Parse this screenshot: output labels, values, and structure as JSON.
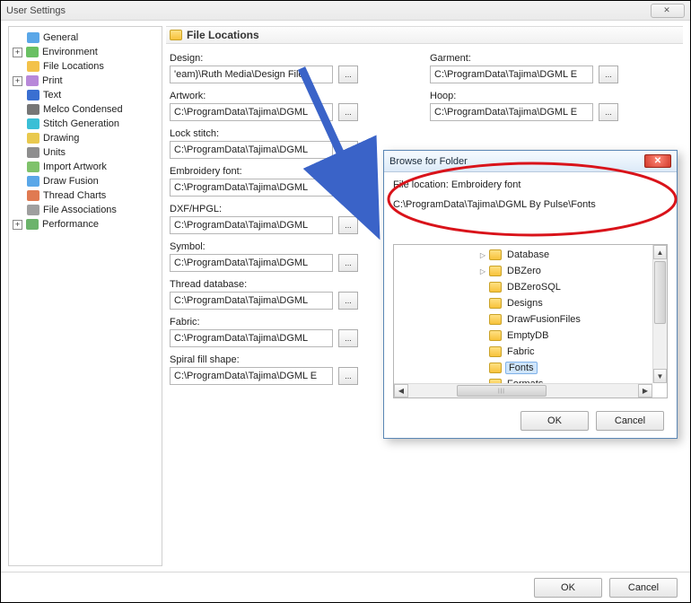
{
  "window": {
    "title": "User Settings",
    "close_glyph": "✕"
  },
  "sidebar": {
    "items": [
      {
        "label": "General",
        "expander": " ",
        "icon_color": "#5aa7e8"
      },
      {
        "label": "Environment",
        "expander": "+",
        "icon_color": "#69c063"
      },
      {
        "label": "File Locations",
        "expander": " ",
        "icon_color": "#f3c24a"
      },
      {
        "label": "Print",
        "expander": "+",
        "icon_color": "#b888d9"
      },
      {
        "label": "Text",
        "expander": " ",
        "icon_color": "#3a6fd1"
      },
      {
        "label": "Melco Condensed",
        "expander": " ",
        "icon_color": "#767676"
      },
      {
        "label": "Stitch Generation",
        "expander": " ",
        "icon_color": "#3abfd6"
      },
      {
        "label": "Drawing",
        "expander": " ",
        "icon_color": "#e9c94e"
      },
      {
        "label": "Units",
        "expander": " ",
        "icon_color": "#8e8e8e"
      },
      {
        "label": "Import Artwork",
        "expander": " ",
        "icon_color": "#7fc26b"
      },
      {
        "label": "Draw Fusion",
        "expander": " ",
        "icon_color": "#5aa7e8"
      },
      {
        "label": "Thread Charts",
        "expander": " ",
        "icon_color": "#e07a52"
      },
      {
        "label": "File Associations",
        "expander": " ",
        "icon_color": "#9f9f9f"
      },
      {
        "label": "Performance",
        "expander": "+",
        "icon_color": "#6bb36b"
      }
    ]
  },
  "panel": {
    "title": "File Locations",
    "left": [
      {
        "key": "design",
        "label": "Design:",
        "path": "'eam)\\Ruth Media\\Design Files"
      },
      {
        "key": "artwork",
        "label": "Artwork:",
        "path": "C:\\ProgramData\\Tajima\\DGML"
      },
      {
        "key": "lockstitch",
        "label": "Lock stitch:",
        "path": "C:\\ProgramData\\Tajima\\DGML"
      },
      {
        "key": "embfont",
        "label": "Embroidery font:",
        "path": "C:\\ProgramData\\Tajima\\DGML",
        "highlighted": true
      },
      {
        "key": "dxf",
        "label": "DXF/HPGL:",
        "path": "C:\\ProgramData\\Tajima\\DGML"
      },
      {
        "key": "symbol",
        "label": "Symbol:",
        "path": "C:\\ProgramData\\Tajima\\DGML"
      },
      {
        "key": "threaddb",
        "label": "Thread database:",
        "path": "C:\\ProgramData\\Tajima\\DGML"
      },
      {
        "key": "fabric",
        "label": "Fabric:",
        "path": "C:\\ProgramData\\Tajima\\DGML"
      },
      {
        "key": "spiral",
        "label": "Spiral fill shape:",
        "path": "C:\\ProgramData\\Tajima\\DGML E"
      }
    ],
    "right_top": [
      {
        "key": "garment",
        "label": "Garment:",
        "path": "C:\\ProgramData\\Tajima\\DGML E"
      },
      {
        "key": "hoop",
        "label": "Hoop:",
        "path": "C:\\ProgramData\\Tajima\\DGML E"
      }
    ],
    "browse_glyph": "..."
  },
  "dialog": {
    "title": "Browse for Folder",
    "close_glyph": "✕",
    "line1_prefix": "File location: ",
    "line1_value": "Embroidery font",
    "line2": "C:\\ProgramData\\Tajima\\DGML By Pulse\\Fonts",
    "folders": [
      {
        "name": "Database",
        "tri": "▷",
        "selected": false
      },
      {
        "name": "DBZero",
        "tri": "▷",
        "selected": false
      },
      {
        "name": "DBZeroSQL",
        "tri": " ",
        "selected": false
      },
      {
        "name": "Designs",
        "tri": " ",
        "selected": false
      },
      {
        "name": "DrawFusionFiles",
        "tri": " ",
        "selected": false
      },
      {
        "name": "EmptyDB",
        "tri": " ",
        "selected": false
      },
      {
        "name": "Fabric",
        "tri": " ",
        "selected": false
      },
      {
        "name": "Fonts",
        "tri": " ",
        "selected": true
      },
      {
        "name": "Formats",
        "tri": " ",
        "selected": false
      }
    ],
    "ok": "OK",
    "cancel": "Cancel"
  },
  "buttons": {
    "ok": "OK",
    "cancel": "Cancel"
  }
}
